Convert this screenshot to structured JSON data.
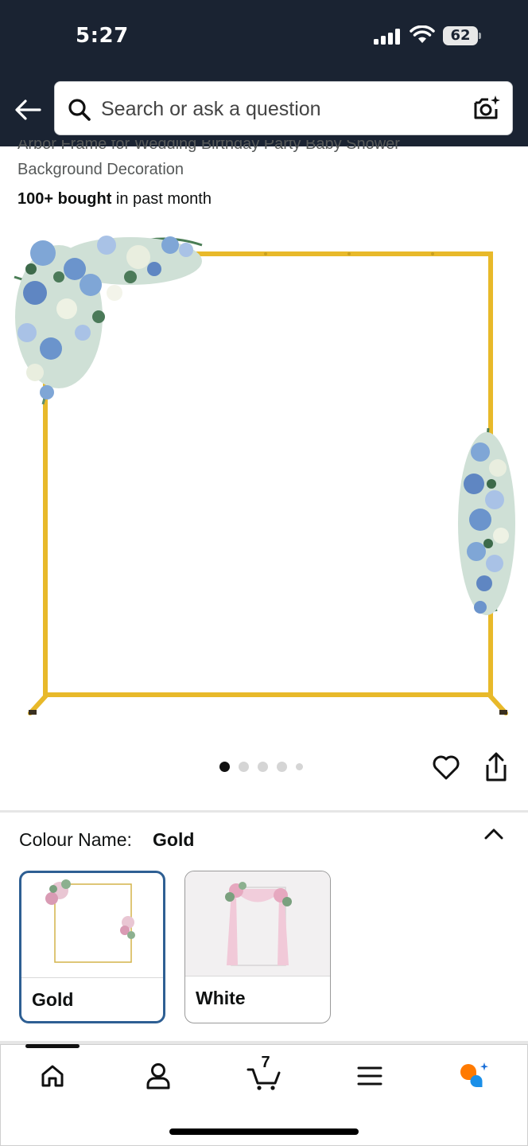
{
  "status_bar": {
    "time": "5:27",
    "battery": "62"
  },
  "search": {
    "placeholder": "Search or ask a question"
  },
  "product": {
    "title_line1": "Arbor Frame for Wedding Birthday Party Baby Shower",
    "title_line2": "Background Decoration",
    "bought_bold": "100+ bought",
    "bought_rest": " in past month",
    "image_count": 5,
    "active_image": 1
  },
  "colour": {
    "label": "Colour Name:",
    "selected": "Gold",
    "options": [
      {
        "label": "Gold"
      },
      {
        "label": "White"
      }
    ]
  },
  "nav": {
    "cart_count": "7"
  },
  "colors": {
    "header_bg": "#1a2332",
    "frame_gold": "#e8b92a",
    "swatch_selected_border": "#2e5f93"
  }
}
